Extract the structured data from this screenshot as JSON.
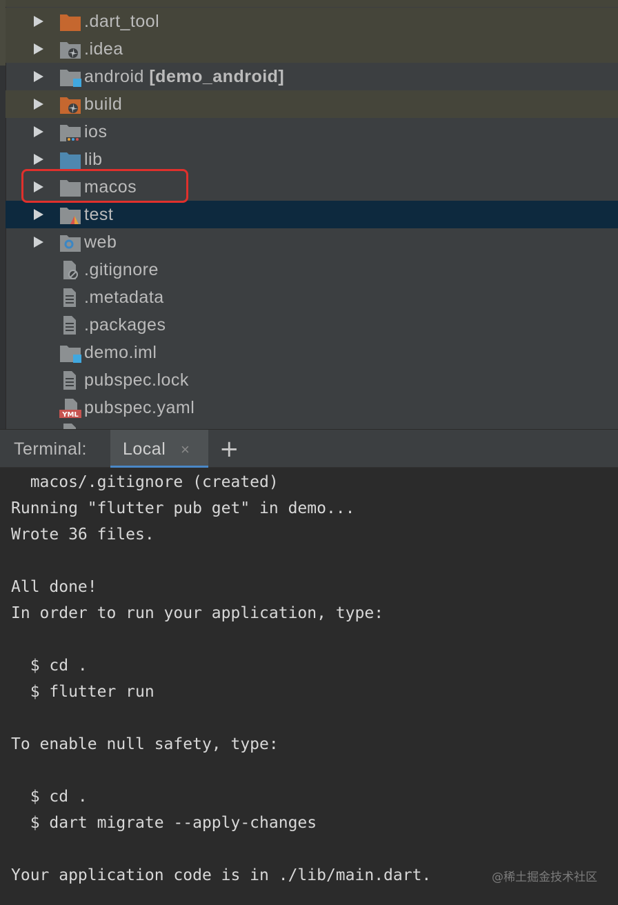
{
  "tree": {
    "items": [
      {
        "label": "dart_tool_label",
        "text": ".dart_tool",
        "icon": "folder-orange-icon"
      },
      {
        "text": ".idea",
        "icon": "idea-config-folder-icon"
      },
      {
        "text": "android",
        "module": "[demo_android]",
        "icon": "module-folder-icon"
      },
      {
        "text": "build",
        "icon": "build-excluded-folder-icon"
      },
      {
        "text": "ios",
        "icon": "ios-folder-icon"
      },
      {
        "text": "lib",
        "icon": "source-folder-icon"
      },
      {
        "text": "macos",
        "icon": "folder-icon"
      },
      {
        "text": "test",
        "icon": "test-folder-icon"
      },
      {
        "text": "web",
        "icon": "web-folder-icon"
      },
      {
        "text": ".gitignore",
        "icon": "ignore-file-icon"
      },
      {
        "text": ".metadata",
        "icon": "text-file-icon"
      },
      {
        "text": ".packages",
        "icon": "text-file-icon"
      },
      {
        "text": "demo.iml",
        "icon": "iml-file-icon"
      },
      {
        "text": "pubspec.lock",
        "icon": "text-file-icon"
      },
      {
        "text": "pubspec.yaml",
        "icon": "yaml-file-icon"
      }
    ]
  },
  "terminal": {
    "title": "Terminal:",
    "tab_label": "Local",
    "close_glyph": "×",
    "add_glyph": "+",
    "lines": [
      "  macos/.gitignore (created)",
      "Running \"flutter pub get\" in demo...",
      "Wrote 36 files.",
      "",
      "All done!",
      "In order to run your application, type:",
      "",
      "  $ cd .",
      "  $ flutter run",
      "",
      "To enable null safety, type:",
      "",
      "  $ cd .",
      "  $ dart migrate --apply-changes",
      "",
      "Your application code is in ./lib/main.dart."
    ]
  },
  "watermark": "@稀土掘金技术社区",
  "colors": {
    "tree_bg": "#3c3f41",
    "excluded_row": "#45453a",
    "selected_row": "#0d293e",
    "highlight_box": "#e0302c",
    "terminal_bg": "#2b2b2b",
    "tab_underline": "#4a88c7"
  }
}
